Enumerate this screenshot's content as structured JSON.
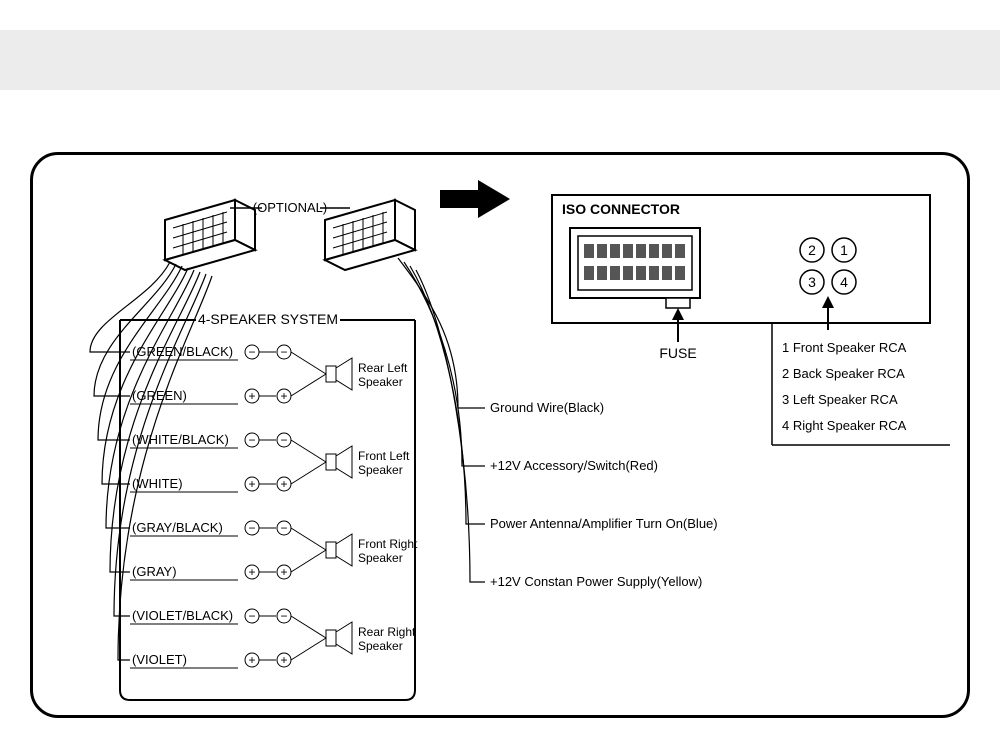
{
  "optional_label": "(OPTIONAL)",
  "speaker_system_title": "4-SPEAKER SYSTEM",
  "iso_title": "ISO CONNECTOR",
  "fuse_label": "FUSE",
  "wires": [
    {
      "color": "(GREEN/BLACK)",
      "polarity": "−"
    },
    {
      "color": "(GREEN)",
      "polarity": "+"
    },
    {
      "color": "(WHITE/BLACK)",
      "polarity": "−"
    },
    {
      "color": "(WHITE)",
      "polarity": "+"
    },
    {
      "color": "(GRAY/BLACK)",
      "polarity": "−"
    },
    {
      "color": "(GRAY)",
      "polarity": "+"
    },
    {
      "color": "(VIOLET/BLACK)",
      "polarity": "−"
    },
    {
      "color": "(VIOLET)",
      "polarity": "+"
    }
  ],
  "speakers": [
    {
      "line1": "Rear Left",
      "line2": "Speaker"
    },
    {
      "line1": "Front Left",
      "line2": "Speaker"
    },
    {
      "line1": "Front Right",
      "line2": "Speaker"
    },
    {
      "line1": "Rear Right",
      "line2": "Speaker"
    }
  ],
  "power_wires": [
    "Ground Wire(Black)",
    "+12V Accessory/Switch(Red)",
    "Power Antenna/Amplifier Turn On(Blue)",
    "+12V Constan Power Supply(Yellow)"
  ],
  "rca": {
    "nums": [
      "2",
      "1",
      "3",
      "4"
    ],
    "items": [
      "1 Front Speaker RCA",
      "2 Back Speaker RCA",
      "3 Left  Speaker RCA",
      "4 Right  Speaker RCA"
    ]
  }
}
